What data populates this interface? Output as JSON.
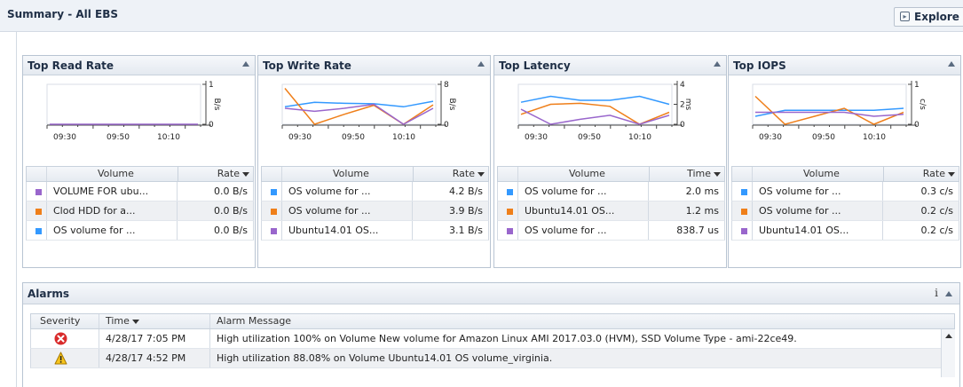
{
  "page": {
    "title": "Summary - All EBS",
    "explore_label": "Explore"
  },
  "colors": {
    "blue": "#3399ff",
    "orange": "#ef7f1a",
    "purple": "#9966cc"
  },
  "panels": [
    {
      "title": "Top Read Rate",
      "col_name": "Volume",
      "col_value": "Rate",
      "unit_label": "B/s",
      "y_ticks": [
        "1",
        "0"
      ],
      "rows": [
        {
          "name": "VOLUME FOR ubu...",
          "value": "0.0 B/s",
          "color": "purple"
        },
        {
          "name": "Clod HDD for a...",
          "value": "0.0 B/s",
          "color": "orange"
        },
        {
          "name": "OS volume for ...",
          "value": "0.0 B/s",
          "color": "blue"
        }
      ]
    },
    {
      "title": "Top Write Rate",
      "col_name": "Volume",
      "col_value": "Rate",
      "unit_label": "B/s",
      "y_ticks": [
        "8",
        "0"
      ],
      "rows": [
        {
          "name": "OS volume for ...",
          "value": "4.2 B/s",
          "color": "blue"
        },
        {
          "name": "OS volume for ...",
          "value": "3.9 B/s",
          "color": "orange"
        },
        {
          "name": "Ubuntu14.01 OS...",
          "value": "3.1 B/s",
          "color": "purple"
        }
      ]
    },
    {
      "title": "Top Latency",
      "col_name": "Volume",
      "col_value": "Time",
      "unit_label": "ms",
      "y_ticks": [
        "4",
        "2",
        "0"
      ],
      "rows": [
        {
          "name": "OS volume for ...",
          "value": "2.0 ms",
          "color": "blue"
        },
        {
          "name": "Ubuntu14.01 OS...",
          "value": "1.2 ms",
          "color": "orange"
        },
        {
          "name": "OS volume for ...",
          "value": "838.7 us",
          "color": "purple"
        }
      ]
    },
    {
      "title": "Top IOPS",
      "col_name": "Volume",
      "col_value": "Rate",
      "unit_label": "c/s",
      "y_ticks": [
        "1",
        "0"
      ],
      "rows": [
        {
          "name": "OS volume for ...",
          "value": "0.3 c/s",
          "color": "blue"
        },
        {
          "name": "OS volume for ...",
          "value": "0.2 c/s",
          "color": "orange"
        },
        {
          "name": "Ubuntu14.01 OS...",
          "value": "0.2 c/s",
          "color": "purple"
        }
      ]
    }
  ],
  "chart_data": [
    {
      "type": "line",
      "title": "Top Read Rate",
      "x": [
        "09:30",
        "09:50",
        "10:10"
      ],
      "ylim": [
        0,
        1
      ],
      "series": [
        {
          "color": "purple",
          "values": [
            0,
            0,
            0,
            0,
            0,
            0,
            0
          ]
        }
      ]
    },
    {
      "type": "line",
      "title": "Top Write Rate",
      "x": [
        "09:30",
        "09:50",
        "10:10"
      ],
      "ylim": [
        0,
        8
      ],
      "series": [
        {
          "color": "blue",
          "values": [
            3.5,
            4.4,
            4.2,
            4.1,
            3.5,
            4.6
          ]
        },
        {
          "color": "orange",
          "values": [
            7.2,
            0,
            2.0,
            3.8,
            0,
            3.9
          ]
        },
        {
          "color": "purple",
          "values": [
            3.2,
            2.6,
            3.2,
            4.0,
            0,
            3.2
          ]
        }
      ]
    },
    {
      "type": "line",
      "title": "Top Latency",
      "x": [
        "09:30",
        "09:50",
        "10:10"
      ],
      "ylim": [
        0,
        4
      ],
      "series": [
        {
          "color": "blue",
          "values": [
            2.2,
            2.8,
            2.4,
            2.4,
            2.8,
            2.0
          ]
        },
        {
          "color": "orange",
          "values": [
            1.0,
            2.0,
            2.1,
            1.8,
            0,
            1.2
          ]
        },
        {
          "color": "purple",
          "values": [
            1.5,
            0,
            0.5,
            0.9,
            0,
            0.9
          ]
        }
      ]
    },
    {
      "type": "line",
      "title": "Top IOPS",
      "x": [
        "09:30",
        "09:50",
        "10:10"
      ],
      "ylim": [
        0,
        1
      ],
      "series": [
        {
          "color": "blue",
          "values": [
            0.2,
            0.35,
            0.35,
            0.35,
            0.35,
            0.4
          ]
        },
        {
          "color": "orange",
          "values": [
            0.7,
            0,
            0.2,
            0.4,
            0,
            0.3
          ]
        },
        {
          "color": "purple",
          "values": [
            0.3,
            0.3,
            0.3,
            0.3,
            0.2,
            0.25
          ]
        }
      ]
    }
  ],
  "alarms": {
    "title": "Alarms",
    "columns": {
      "severity": "Severity",
      "time": "Time",
      "message": "Alarm Message"
    },
    "rows": [
      {
        "severity": "critical",
        "severity_icon": "critical-icon",
        "time": "4/28/17 7:05 PM",
        "message": "High utilization 100% on Volume New volume for Amazon Linux AMI 2017.03.0 (HVM), SSD Volume Type - ami-22ce49."
      },
      {
        "severity": "warning",
        "severity_icon": "warning-icon",
        "time": "4/28/17 4:52 PM",
        "message": "High utilization 88.08% on Volume Ubuntu14.01 OS volume_virginia."
      }
    ]
  }
}
